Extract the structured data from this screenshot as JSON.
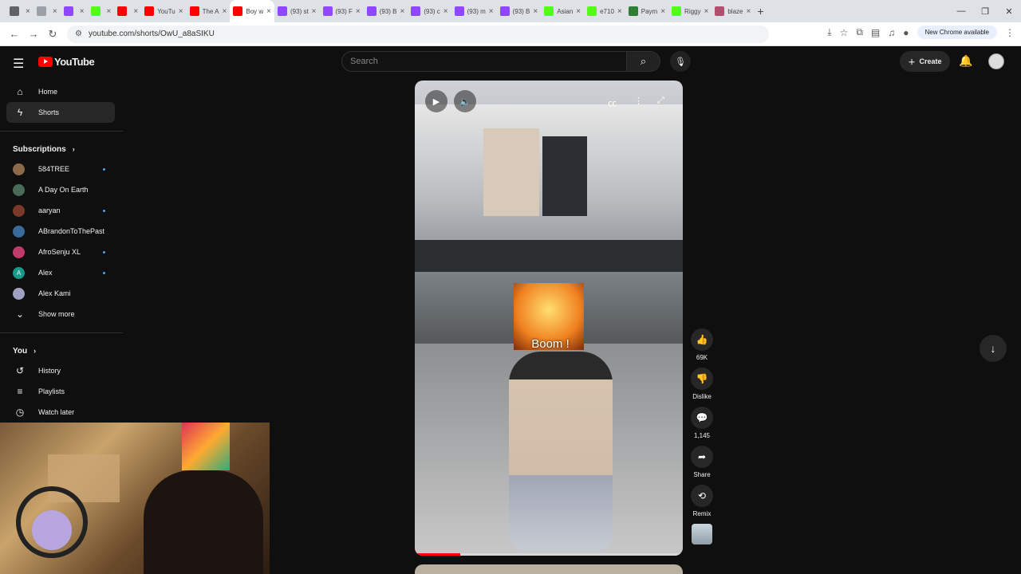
{
  "browser": {
    "tabs": [
      {
        "title": "",
        "color": "#5f6368",
        "active": false
      },
      {
        "title": "",
        "color": "#9aa0a6",
        "active": false
      },
      {
        "title": "",
        "color": "#9146ff",
        "active": false
      },
      {
        "title": "",
        "color": "#53fc18",
        "active": false
      },
      {
        "title": "",
        "color": "#ff0000",
        "active": false
      },
      {
        "title": "YouTu",
        "color": "#ff0000",
        "active": false
      },
      {
        "title": "The A",
        "color": "#ff0000",
        "active": false
      },
      {
        "title": "Boy w",
        "color": "#ff0000",
        "active": true
      },
      {
        "title": "(93) st",
        "color": "#9146ff",
        "active": false
      },
      {
        "title": "(93) F",
        "color": "#9146ff",
        "active": false
      },
      {
        "title": "(93) B",
        "color": "#9146ff",
        "active": false
      },
      {
        "title": "(93) c",
        "color": "#9146ff",
        "active": false
      },
      {
        "title": "(93) m",
        "color": "#9146ff",
        "active": false
      },
      {
        "title": "(93) B",
        "color": "#9146ff",
        "active": false
      },
      {
        "title": "Asian",
        "color": "#53fc18",
        "active": false
      },
      {
        "title": "e710",
        "color": "#53fc18",
        "active": false
      },
      {
        "title": "Paym",
        "color": "#2e7d32",
        "active": false
      },
      {
        "title": "Riggy",
        "color": "#53fc18",
        "active": false
      },
      {
        "title": "blaze",
        "color": "#b05070",
        "active": false
      }
    ],
    "url": "youtube.com/shorts/OwU_a8aSIKU",
    "new_chrome": "New Chrome available"
  },
  "youtube": {
    "logo": "YouTube",
    "search_placeholder": "Search",
    "create_label": "Create"
  },
  "sidebar": {
    "items": [
      {
        "label": "Home",
        "icon": "home-icon"
      },
      {
        "label": "Shorts",
        "icon": "shorts-icon"
      }
    ],
    "subscriptions_label": "Subscriptions",
    "subscriptions": [
      {
        "name": "584TREE",
        "color": "#8a6a4a",
        "live_dot": true
      },
      {
        "name": "A Day On Earth",
        "color": "#4a6a5a",
        "live_dot": false
      },
      {
        "name": "aaryan",
        "color": "#7a3a2a",
        "live_dot": true
      },
      {
        "name": "ABrandonToThePast",
        "color": "#3a6a9a",
        "live_dot": false
      },
      {
        "name": "AfroSenju XL",
        "color": "#c03a6a",
        "live_dot": true
      },
      {
        "name": "Alex",
        "color": "#1a9a8a",
        "live_dot": true,
        "initial": "A"
      },
      {
        "name": "Alex Kami",
        "color": "#a0a0c0",
        "live_dot": false
      }
    ],
    "show_more": "Show more",
    "you_label": "You",
    "you_items": [
      {
        "label": "History",
        "icon": "history-icon"
      },
      {
        "label": "Playlists",
        "icon": "playlists-icon"
      },
      {
        "label": "Watch later",
        "icon": "watch-later-icon"
      }
    ]
  },
  "short": {
    "sticker_text": "Boom !",
    "progress": 0.17
  },
  "actions": {
    "likes": "69K",
    "dislike": "Dislike",
    "comments": "1,145",
    "share": "Share",
    "remix": "Remix"
  }
}
